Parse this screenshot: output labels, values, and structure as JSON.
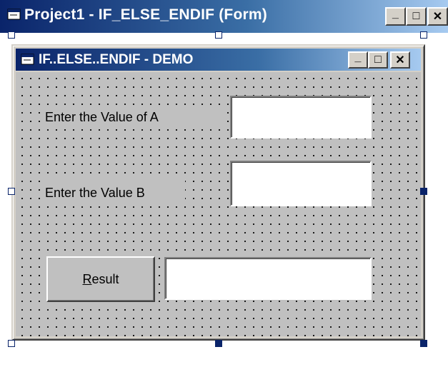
{
  "outer_window": {
    "title": "Project1 - IF_ELSE_ENDIF (Form)",
    "icon": "form-icon",
    "buttons": {
      "minimize": "_",
      "maximize": "□",
      "close": "✕"
    }
  },
  "form": {
    "title": "IF..ELSE..ENDIF - DEMO",
    "icon": "form-icon",
    "buttons": {
      "minimize": "_",
      "maximize": "□",
      "close": "✕"
    },
    "label_a": "Enter the Value of A",
    "label_b": "Enter the Value B",
    "textbox_a_value": "",
    "textbox_b_value": "",
    "result_button": {
      "accel": "R",
      "rest": "esult"
    },
    "result_textbox_value": ""
  },
  "colors": {
    "titlebar_start": "#0a246a",
    "titlebar_end": "#a6caf0",
    "form_background": "#c0c0c0",
    "handle": "#0a246a"
  }
}
